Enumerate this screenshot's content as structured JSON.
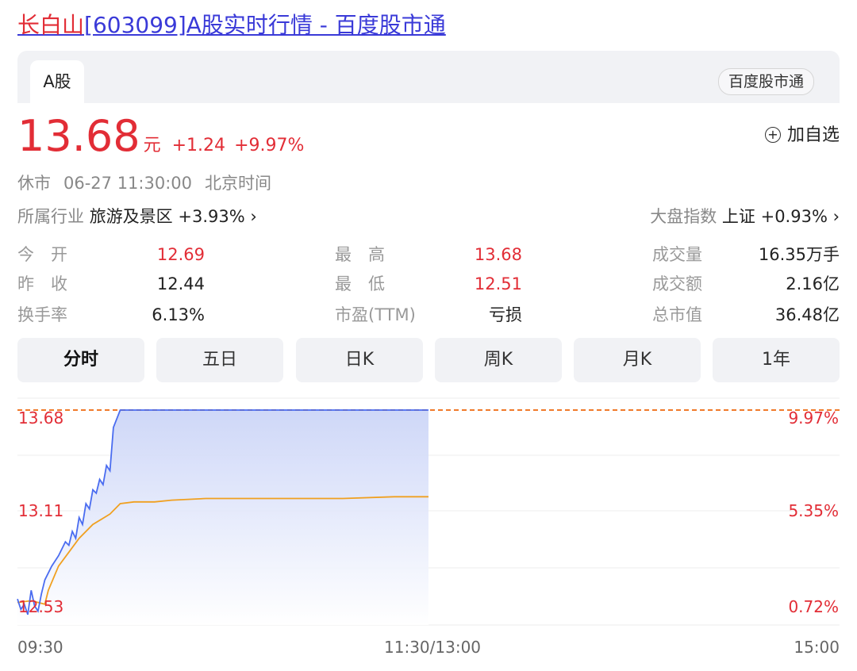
{
  "page": {
    "title_highlight": "长白山",
    "title_rest": "[603099]A股实时行情 - 百度股市通"
  },
  "tabs": {
    "market_tab": "A股",
    "source_button": "百度股市通"
  },
  "quote": {
    "price": "13.68",
    "unit": "元",
    "change": "+1.24",
    "change_pct": "+9.97%",
    "add_watch_label": "加自选",
    "add_watch_icon": "plus-circle-icon",
    "status": "休市",
    "datetime": "06-27 11:30:00",
    "timezone": "北京时间"
  },
  "industry": {
    "label": "所属行业",
    "name": "旅游及景区",
    "change": "+3.93%",
    "arrow": "›"
  },
  "index": {
    "label": "大盘指数",
    "name": "上证",
    "change": "+0.93%",
    "arrow": "›"
  },
  "stats": [
    {
      "label": "今　开",
      "value": "12.69"
    },
    {
      "label": "最　高",
      "value": "13.68"
    },
    {
      "label": "成交量",
      "value": "16.35万手"
    },
    {
      "label": "昨　收",
      "value": "12.44"
    },
    {
      "label": "最　低",
      "value": "12.51"
    },
    {
      "label": "成交额",
      "value": "2.16亿"
    },
    {
      "label": "换手率",
      "value": "6.13%"
    },
    {
      "label": "市盈(TTM)",
      "value": "亏损"
    },
    {
      "label": "总市值",
      "value": "36.48亿"
    }
  ],
  "periods": [
    "分时",
    "五日",
    "日K",
    "周K",
    "月K",
    "1年"
  ],
  "active_period": "分时",
  "colors": {
    "up": "#e22d36",
    "price_line": "#4a6cf0",
    "avg_line": "#f0a020",
    "limit_line": "#f07a2a"
  },
  "chart_data": {
    "type": "line",
    "x_ticks": [
      "09:30",
      "11:30/13:00",
      "15:00"
    ],
    "y_left_labels": [
      "13.68",
      "13.11",
      "12.53"
    ],
    "y_right_labels": [
      "9.97%",
      "5.35%",
      "0.72%"
    ],
    "ylim": [
      12.44,
      13.68
    ],
    "session_minutes": 240,
    "series": [
      {
        "points": [
          [
            0,
            12.59
          ],
          [
            1,
            12.53
          ],
          [
            2,
            12.56
          ],
          [
            3,
            12.5
          ],
          [
            4,
            12.64
          ],
          [
            5,
            12.55
          ],
          [
            6,
            12.52
          ],
          [
            7,
            12.62
          ],
          [
            8,
            12.7
          ],
          [
            10,
            12.78
          ],
          [
            12,
            12.84
          ],
          [
            14,
            12.92
          ],
          [
            15,
            12.9
          ],
          [
            16,
            12.98
          ],
          [
            17,
            12.94
          ],
          [
            18,
            13.06
          ],
          [
            19,
            13.02
          ],
          [
            20,
            13.14
          ],
          [
            21,
            13.11
          ],
          [
            22,
            13.22
          ],
          [
            23,
            13.2
          ],
          [
            24,
            13.28
          ],
          [
            25,
            13.25
          ],
          [
            26,
            13.36
          ],
          [
            27,
            13.33
          ],
          [
            28,
            13.58
          ],
          [
            30,
            13.68
          ],
          [
            60,
            13.68
          ],
          [
            90,
            13.68
          ],
          [
            120,
            13.68
          ]
        ]
      },
      {
        "points": [
          [
            0,
            12.57
          ],
          [
            4,
            12.58
          ],
          [
            8,
            12.56
          ],
          [
            9,
            12.64
          ],
          [
            12,
            12.78
          ],
          [
            15,
            12.86
          ],
          [
            18,
            12.94
          ],
          [
            22,
            13.02
          ],
          [
            27,
            13.08
          ],
          [
            30,
            13.14
          ],
          [
            34,
            13.15
          ],
          [
            40,
            13.15
          ],
          [
            45,
            13.16
          ],
          [
            55,
            13.17
          ],
          [
            70,
            13.17
          ],
          [
            95,
            13.17
          ],
          [
            110,
            13.18
          ],
          [
            120,
            13.18
          ]
        ]
      }
    ]
  }
}
